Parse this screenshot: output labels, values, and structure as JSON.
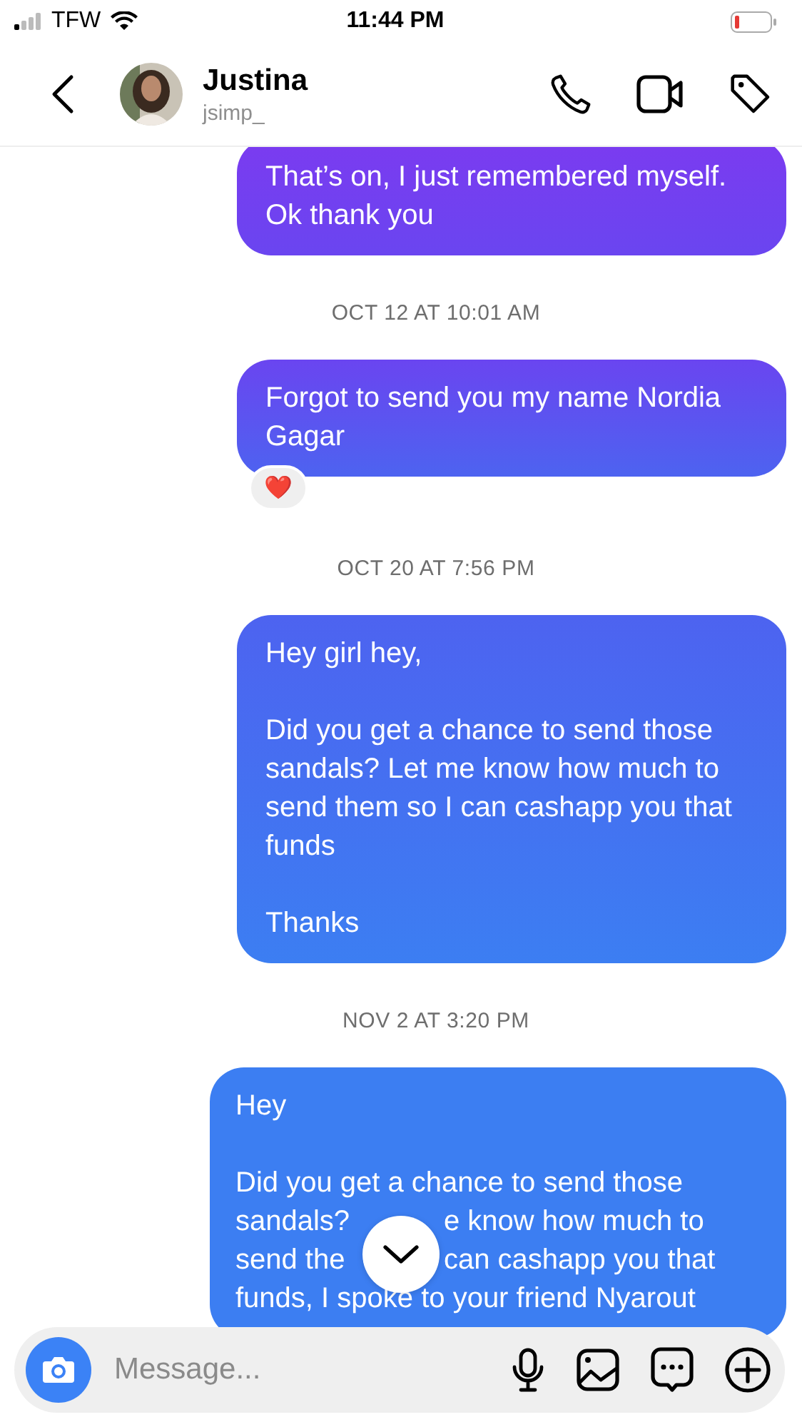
{
  "status_bar": {
    "carrier": "TFW",
    "time": "11:44 PM"
  },
  "header": {
    "name": "Justina",
    "username": "jsimp_"
  },
  "thread": [
    {
      "kind": "message",
      "text": "That’s on, I just remembered myself. Ok thank you"
    },
    {
      "kind": "timestamp",
      "text": "OCT 12 AT 10:01 AM"
    },
    {
      "kind": "message",
      "text": "Forgot to send you my name Nordia Gagar",
      "reaction": "❤️"
    },
    {
      "kind": "timestamp",
      "text": "OCT 20 AT 7:56 PM"
    },
    {
      "kind": "message",
      "text": "Hey girl hey,\n\nDid you get a chance to send those sandals? Let me know how much to send them so I can cashapp you that funds\n\nThanks"
    },
    {
      "kind": "timestamp",
      "text": "NOV 2 AT 3:20 PM"
    },
    {
      "kind": "message",
      "paragraphs": [
        [
          [
            "Hey"
          ]
        ],
        [
          [
            "Did you get a chance to send those"
          ],
          [
            "sandals?",
            "e know how much to"
          ],
          [
            "send the",
            "can cashapp you that"
          ],
          [
            "funds, I spoke to your friend Nyarout"
          ]
        ]
      ]
    }
  ],
  "composer": {
    "placeholder": "Message..."
  }
}
